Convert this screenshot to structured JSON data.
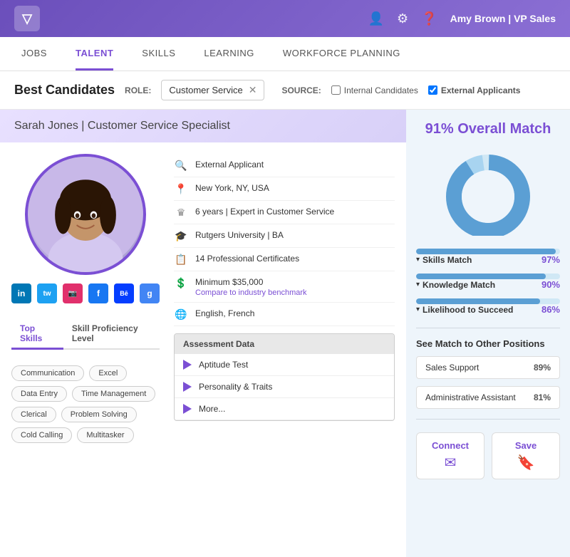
{
  "app": {
    "logo": "▽",
    "user": "Amy Brown | VP Sales",
    "icons": [
      "person",
      "gear",
      "question"
    ]
  },
  "nav": {
    "tabs": [
      "JOBS",
      "TALENT",
      "SKILLS",
      "LEARNING",
      "WORKFORCE PLANNING"
    ],
    "active": "TALENT"
  },
  "candidates_bar": {
    "title": "Best Candidates",
    "role_label": "ROLE:",
    "role_value": "Customer Service",
    "source_label": "SOURCE:",
    "internal_label": "Internal Candidates",
    "external_label": "External Applicants",
    "internal_checked": false,
    "external_checked": true
  },
  "candidate": {
    "name": "Sarah Jones",
    "title": "Customer Service Specialist",
    "details": [
      {
        "icon": "🔍",
        "text": "External Applicant"
      },
      {
        "icon": "📍",
        "text": "New York, NY, USA"
      },
      {
        "icon": "👑",
        "text": "6 years | Expert in Customer Service"
      },
      {
        "icon": "🎓",
        "text": "Rutgers University | BA"
      },
      {
        "icon": "📋",
        "text": "14 Professional Certificates"
      },
      {
        "icon": "💲",
        "text": "Minimum $35,000",
        "link": "Compare to industry benchmark"
      },
      {
        "icon": "🌐",
        "text": "English, French"
      }
    ],
    "social": [
      {
        "id": "li",
        "label": "in",
        "class": "si-li"
      },
      {
        "id": "tw",
        "label": "🐦",
        "class": "si-tw"
      },
      {
        "id": "ig",
        "label": "📷",
        "class": "si-ig"
      },
      {
        "id": "fb",
        "label": "f",
        "class": "si-fb"
      },
      {
        "id": "be",
        "label": "Bē",
        "class": "si-be"
      },
      {
        "id": "gl",
        "label": "g",
        "class": "si-gl"
      }
    ],
    "skills_tabs": [
      "Top Skills",
      "Skill Proficiency Level"
    ],
    "active_skills_tab": "Top Skills",
    "skill_tags": [
      "Communication",
      "Excel",
      "Data Entry",
      "Time Management",
      "Clerical",
      "Problem Solving",
      "Cold Calling",
      "Multitasker"
    ],
    "assessment": {
      "title": "Assessment Data",
      "items": [
        "Aptitude Test",
        "Personality & Traits",
        "More..."
      ]
    }
  },
  "match": {
    "overall": "91% Overall Match",
    "bars": [
      {
        "label": "Skills Match",
        "pct": 97,
        "pct_label": "97%"
      },
      {
        "label": "Knowledge Match",
        "pct": 90,
        "pct_label": "90%"
      },
      {
        "label": "Likelihood to Succeed",
        "pct": 86,
        "pct_label": "86%"
      }
    ],
    "other_title": "See Match to Other Positions",
    "positions": [
      {
        "name": "Sales Support",
        "pct": "89%"
      },
      {
        "name": "Administrative Assistant",
        "pct": "81%"
      }
    ],
    "actions": [
      {
        "label": "Connect",
        "icon": "✉"
      },
      {
        "label": "Save",
        "icon": "🔖"
      }
    ]
  }
}
